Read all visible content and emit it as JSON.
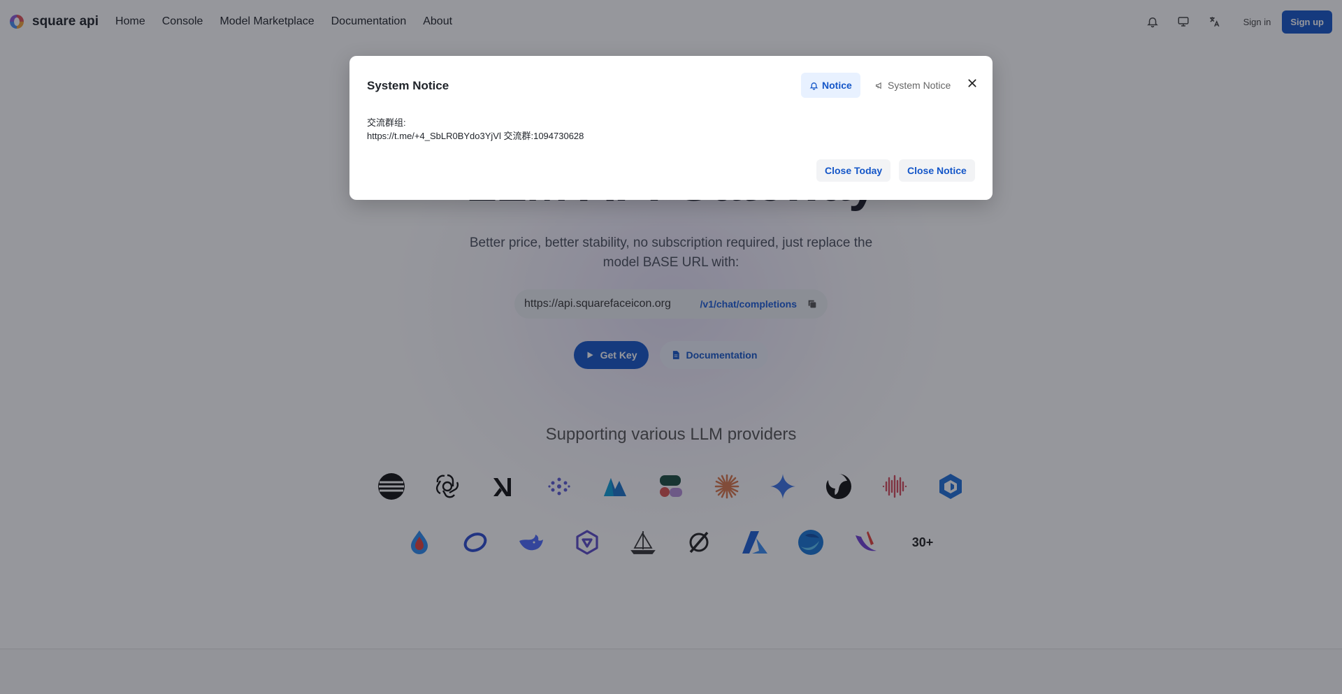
{
  "header": {
    "brand_name": "square api",
    "nav": [
      "Home",
      "Console",
      "Model Marketplace",
      "Documentation",
      "About"
    ],
    "signin_label": "Sign in",
    "signup_label": "Sign up",
    "icons": [
      "bell-icon",
      "monitor-icon",
      "translate-icon"
    ]
  },
  "hero": {
    "title": "LLM API Gateway",
    "subtitle": "Better price, better stability, no subscription required, just replace the model BASE URL with:",
    "base_url": "https://api.squarefaceicon.org",
    "endpoint_path": "/v1/chat/completions",
    "get_key_label": "Get Key",
    "docs_label": "Documentation",
    "providers_title": "Supporting various LLM providers",
    "provider_more": "30+"
  },
  "modal": {
    "title": "System Notice",
    "tab_notice": "Notice",
    "tab_system": "System Notice",
    "body_line1": "交流群组:",
    "body_line2": "https://t.me/+4_SbLR0BYdo3YjVl 交流群:1094730628",
    "close_today_label": "Close Today",
    "close_notice_label": "Close Notice"
  },
  "colors": {
    "primary": "#1456c8",
    "overlay": "#161823"
  }
}
